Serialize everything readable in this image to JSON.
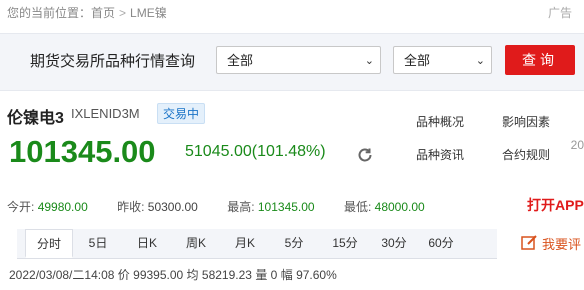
{
  "breadcrumb": {
    "prefix": "您的当前位置：",
    "home": "首页",
    "separator": ">",
    "current": "LME镍"
  },
  "ad_label": "广告",
  "search": {
    "title": "期货交易所品种行情查询",
    "exchange_select": "全部",
    "variety_select": "全部",
    "query_button": "查询"
  },
  "quote": {
    "name": "伦镍电3",
    "code": "IXLENID3M",
    "status": "交易中",
    "price": "101345.00",
    "change": "51045.00(101.48%)"
  },
  "links": {
    "overview": "品种概况",
    "factors": "影响因素",
    "news": "品种资讯",
    "rules": "合约规则",
    "year_fragment": "20"
  },
  "stats": {
    "open_label": "今开:",
    "open": "49980.00",
    "prev_close_label": "昨收:",
    "prev_close": "50300.00",
    "high_label": "最高:",
    "high": "101345.00",
    "low_label": "最低:",
    "low": "48000.00"
  },
  "open_app": "打开APP",
  "tabs": [
    "分时",
    "5日",
    "日K",
    "周K",
    "月K",
    "5分",
    "15分",
    "30分",
    "60分"
  ],
  "feedback": "我要评",
  "bottom_line": {
    "datetime": "2022/03/08/二14:08",
    "price_label": "价",
    "price": "99395.00",
    "avg_label": "均",
    "avg": "58219.23",
    "vol_label": "量",
    "vol": "0",
    "pct_label": "幅",
    "pct": "97.60%"
  },
  "colors": {
    "up_green": "#1a8a1a",
    "accent_red": "#e01b1b",
    "badge_blue": "#1a73c7",
    "panel_bg": "#f3f5f9"
  }
}
